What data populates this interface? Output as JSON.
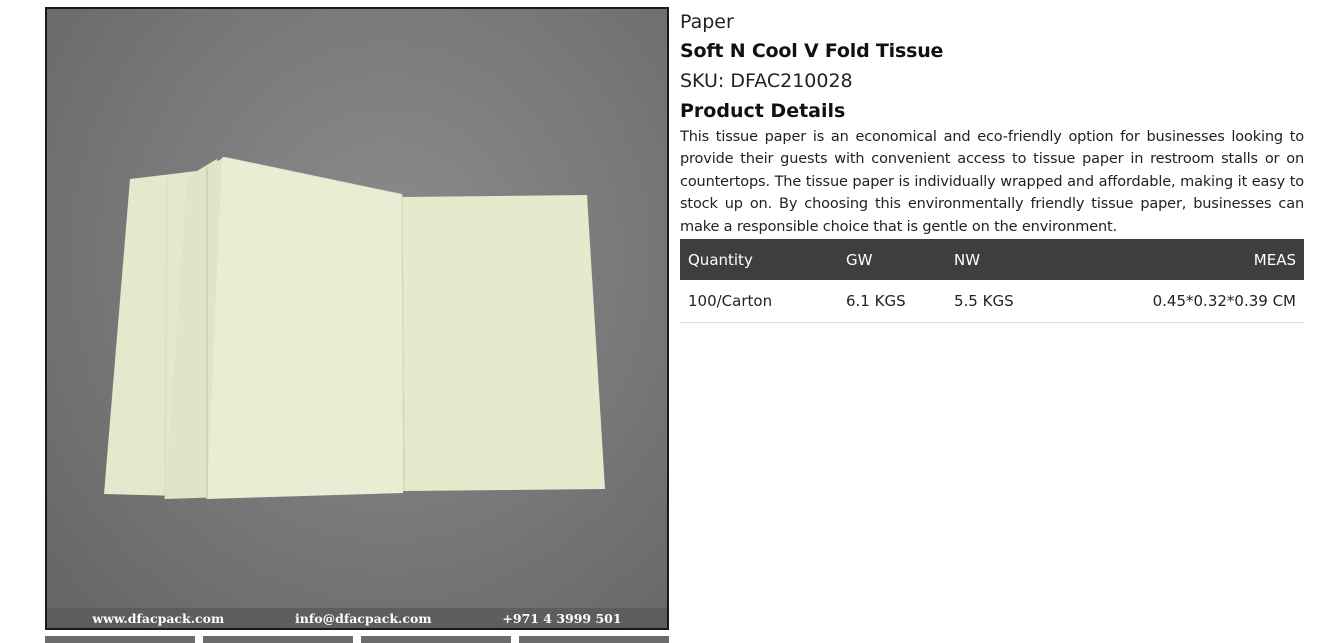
{
  "image": {
    "watermark": {
      "website": "www.dfacpack.com",
      "email": "info@dfacpack.com",
      "phone": "+971 4 3999 501"
    }
  },
  "product": {
    "category": "Paper",
    "title": "Soft N Cool V Fold Tissue",
    "sku_label": "SKU:",
    "sku": "DFAC210028",
    "details_heading": "Product Details",
    "description": "This tissue paper is an economical and eco-friendly option for businesses looking to provide their guests with convenient access to tissue paper in restroom stalls or on countertops. The tissue paper is individually wrapped and affordable, making it easy to stock up on. By choosing this environmentally friendly tissue paper, businesses can make a responsible choice that is gentle on the environment."
  },
  "spec_table": {
    "headers": [
      "Quantity",
      "GW",
      "NW",
      "MEAS"
    ],
    "rows": [
      [
        "100/Carton",
        "6.1 KGS",
        "5.5 KGS",
        "0.45*0.32*0.39 CM"
      ]
    ]
  },
  "colors": {
    "table_header_bg": "#3e3e3e",
    "image_background": "#777777",
    "tissue": "#e6ecd2"
  }
}
